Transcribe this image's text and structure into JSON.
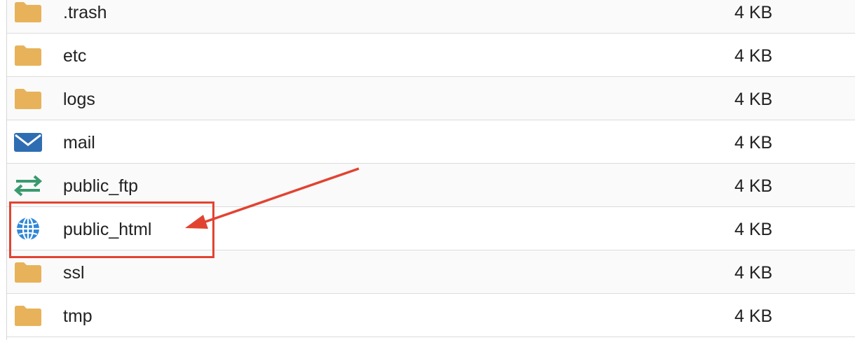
{
  "files": [
    {
      "name": ".trash",
      "size": "4 KB",
      "icon": "folder-icon"
    },
    {
      "name": "etc",
      "size": "4 KB",
      "icon": "folder-icon"
    },
    {
      "name": "logs",
      "size": "4 KB",
      "icon": "folder-icon"
    },
    {
      "name": "mail",
      "size": "4 KB",
      "icon": "mail-icon"
    },
    {
      "name": "public_ftp",
      "size": "4 KB",
      "icon": "transfer-icon"
    },
    {
      "name": "public_html",
      "size": "4 KB",
      "icon": "globe-icon"
    },
    {
      "name": "ssl",
      "size": "4 KB",
      "icon": "folder-icon"
    },
    {
      "name": "tmp",
      "size": "4 KB",
      "icon": "folder-icon"
    }
  ],
  "colors": {
    "folder": "#e8b25a",
    "mail": "#2f6db3",
    "transfer": "#3a9a6f",
    "globe": "#2f87d8",
    "annotation": "#e24331"
  }
}
